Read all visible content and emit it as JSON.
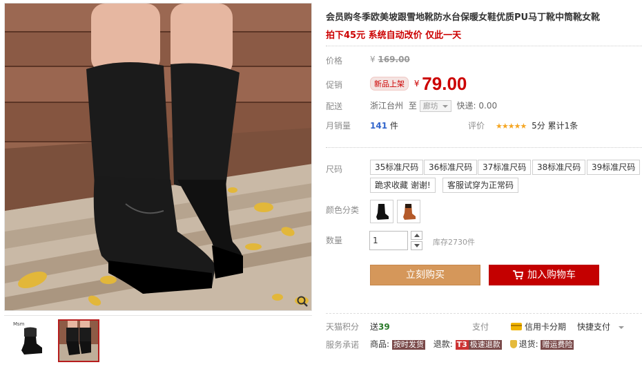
{
  "title": "会员购冬季欧美坡跟雪地靴防水台保暖女鞋优质PU马丁靴中筒靴女靴",
  "subtitle": "拍下45元 系统自动改价 仅此一天",
  "price": {
    "label": "价格",
    "currency": "¥",
    "original": "169.00"
  },
  "promo": {
    "label": "促销",
    "badge": "新品上架",
    "currency": "¥",
    "price": "79.00"
  },
  "shipping": {
    "label": "配送",
    "from": "浙江台州",
    "to_word": "至",
    "destination": "廊坊",
    "express": "快递: 0.00"
  },
  "sales": {
    "label": "月销量",
    "count": "141",
    "unit": "件",
    "rating_label": "评价",
    "stars": "★★★★★",
    "score": "5分",
    "total": "累计1条"
  },
  "sizes": {
    "label": "尺码",
    "options": [
      "35标准尺码",
      "36标准尺码",
      "37标准尺码",
      "38标准尺码",
      "39标准尺码",
      "跪求收藏 谢谢!",
      "客服试穿为正常码"
    ]
  },
  "colors": {
    "label": "颜色分类"
  },
  "quantity": {
    "label": "数量",
    "value": "1",
    "stock": "库存2730件"
  },
  "buttons": {
    "buy": "立刻购买",
    "cart": "加入购物车"
  },
  "points": {
    "label": "天猫积分",
    "prefix": "送",
    "value": "39",
    "pay_label": "支付",
    "credit": "信用卡分期",
    "quick": "快捷支付"
  },
  "service": {
    "label": "服务承诺",
    "goods": "商品:",
    "goods_tag": "按时发货",
    "refund": "退款:",
    "refund_t3": "T3",
    "refund_tag": "极速退款",
    "return": "退货:",
    "return_tag": "赠运费险"
  },
  "gallery": {
    "thumb_tag": "Msm"
  },
  "colors_hex": {
    "accent": "#c40000",
    "buy_button": "#d5975a",
    "price_red": "#cc0000"
  }
}
